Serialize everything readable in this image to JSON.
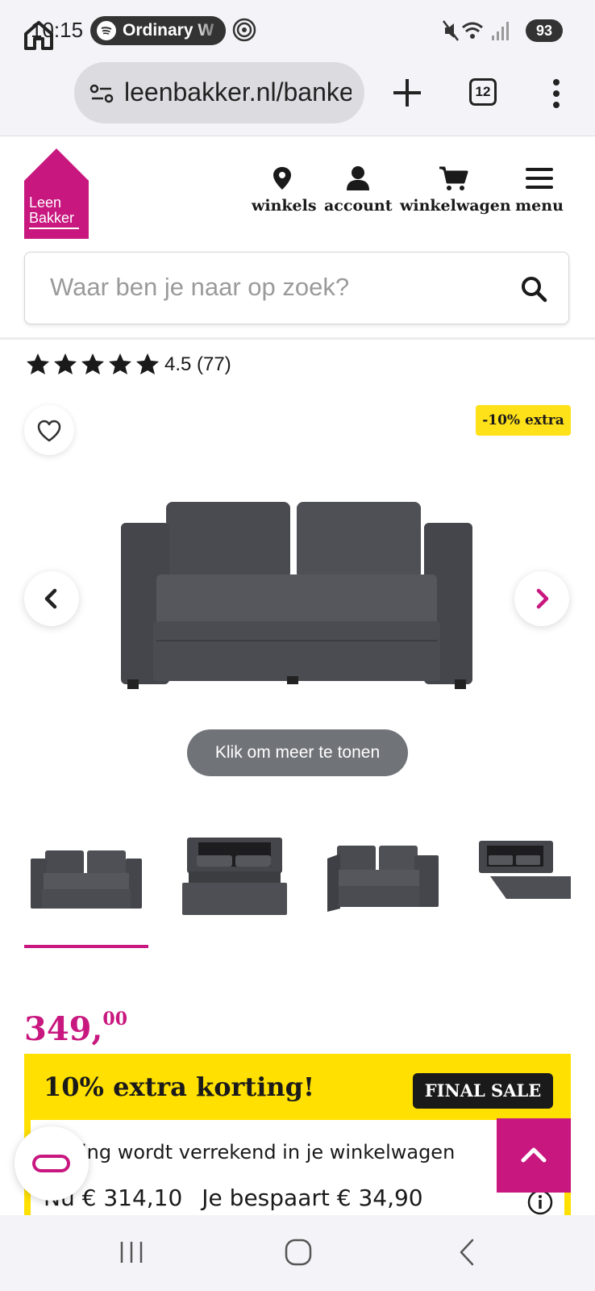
{
  "status_bar": {
    "time": "10:15",
    "media_app_icon": "spotify-icon",
    "media_text": "Ordinary W",
    "battery": "93"
  },
  "browser": {
    "url": "leenbakker.nl/banken",
    "tab_count": "12"
  },
  "site": {
    "logo_line1": "Leen",
    "logo_line2": "Bakker",
    "brand_color": "#c8177f",
    "nav": [
      {
        "icon": "location-pin-icon",
        "label": "winkels"
      },
      {
        "icon": "user-icon",
        "label": "account"
      },
      {
        "icon": "cart-icon",
        "label": "winkelwagen"
      },
      {
        "icon": "hamburger-icon",
        "label": "menu"
      }
    ],
    "search_placeholder": "Waar ben je naar op zoek?"
  },
  "product": {
    "rating_stars": 4.5,
    "rating_text": "4.5 (77)",
    "badge": "-10% extra",
    "show_more": "Klik om meer te tonen",
    "thumbnail_count": 4,
    "active_thumbnail": 1,
    "price_main": "349,",
    "price_cents": "00",
    "promo": {
      "title": "10% extra korting!",
      "final_sale": "FINAL SALE",
      "line1": "korting wordt verrekend in je winkelwagen",
      "now_label": "Nu",
      "now_price": "€ 314,10",
      "save_text": "Je bespaart € 34,90",
      "highlight_color": "#ffe000"
    }
  }
}
